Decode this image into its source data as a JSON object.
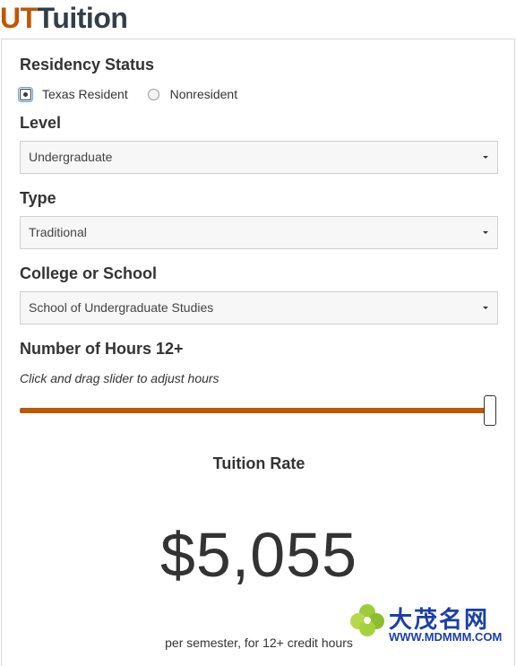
{
  "app": {
    "logo_ut": "UT",
    "logo_tuition": "Tuition"
  },
  "residency": {
    "label": "Residency Status",
    "options": [
      {
        "label": "Texas Resident",
        "checked": true
      },
      {
        "label": "Nonresident",
        "checked": false
      }
    ]
  },
  "level": {
    "label": "Level",
    "value": "Undergraduate"
  },
  "type": {
    "label": "Type",
    "value": "Traditional"
  },
  "college": {
    "label": "College or School",
    "value": "School of Undergraduate Studies"
  },
  "hours": {
    "label": "Number of Hours 12+",
    "hint": "Click and drag slider to adjust hours",
    "slider_fraction": 1.0
  },
  "tuition": {
    "title": "Tuition Rate",
    "amount": "$5,055",
    "caption": "per semester, for 12+ credit hours"
  },
  "colors": {
    "brand_orange": "#bf5700",
    "brand_dark": "#333f48"
  },
  "watermark": {
    "cn": "大茂名网",
    "url": "WWW.MDMMM.COM"
  }
}
